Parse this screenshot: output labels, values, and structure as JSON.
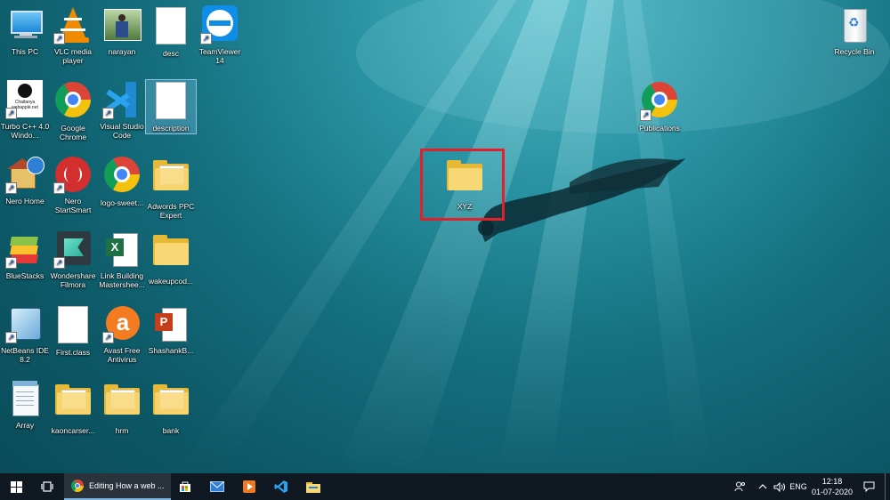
{
  "desktop": {
    "icons": [
      {
        "label": "This PC"
      },
      {
        "label": "VLC media player"
      },
      {
        "label": "narayan"
      },
      {
        "label": "desc"
      },
      {
        "label": "TeamViewer 14"
      },
      {
        "label": "Turbo C++ 4.0 Windo..."
      },
      {
        "label": "Google Chrome"
      },
      {
        "label": "Visual Studio Code"
      },
      {
        "label": "description"
      },
      {
        "label": "Nero Home"
      },
      {
        "label": "Nero StartSmart"
      },
      {
        "label": "logo-sweet..."
      },
      {
        "label": "Adwords PPC Expert"
      },
      {
        "label": "BlueStacks"
      },
      {
        "label": "Wondershare Filmora"
      },
      {
        "label": "Link Building Mastershee..."
      },
      {
        "label": "wakeupcod..."
      },
      {
        "label": "NetBeans IDE 8.2"
      },
      {
        "label": "First.class"
      },
      {
        "label": "Avast Free Antivirus"
      },
      {
        "label": "ShashankB..."
      },
      {
        "label": "Array"
      },
      {
        "label": "kaoncarser..."
      },
      {
        "label": "hrm"
      },
      {
        "label": "bank"
      },
      {
        "label": "Recycle Bin"
      },
      {
        "label": "Publications"
      },
      {
        "label": "XYZ"
      }
    ],
    "turbo_icon_text": "Chaitanya\nwebapple.net"
  },
  "taskbar": {
    "active_window": "Editing How a web ...",
    "tray_lang": "ENG",
    "time": "12:18",
    "date": "01-07-2020"
  },
  "colors": {
    "taskbar": "#101821",
    "highlight": "#e3202a",
    "folder": "#f8d775"
  }
}
